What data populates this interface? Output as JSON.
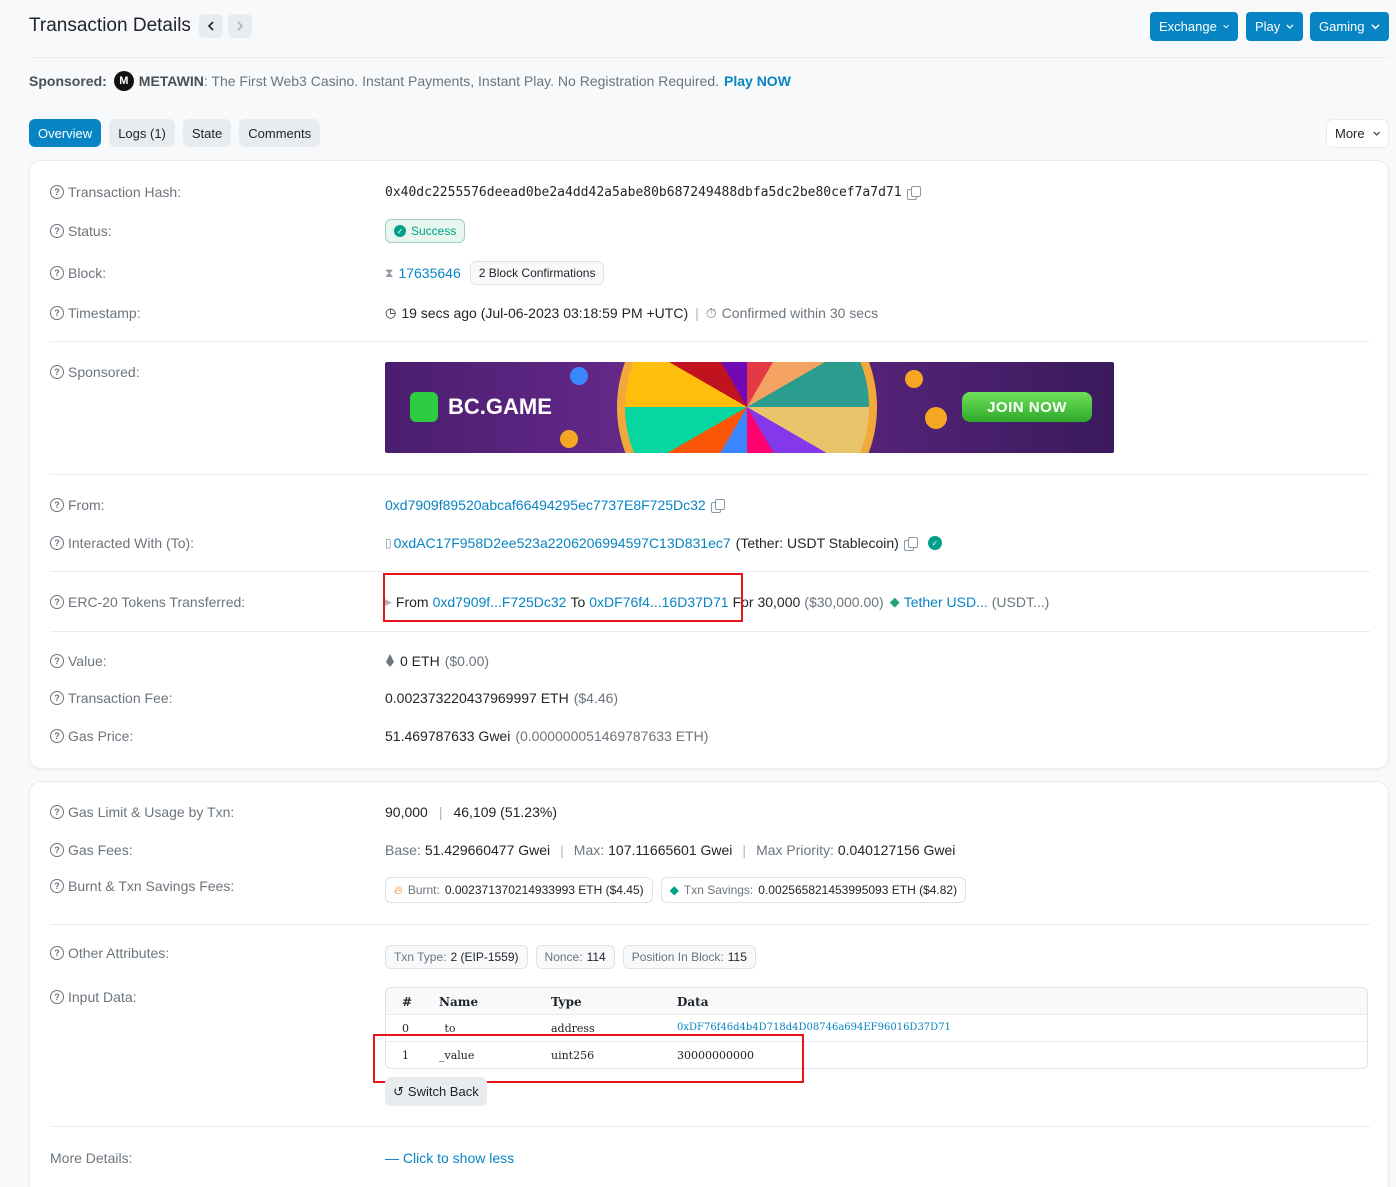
{
  "header": {
    "title": "Transaction Details",
    "buttons": [
      "Exchange",
      "Play",
      "Gaming"
    ]
  },
  "sponsored_line": {
    "label": "Sponsored:",
    "brand": "METAWIN",
    "text": ": The First Web3 Casino. Instant Payments, Instant Play. No Registration Required.",
    "cta": "Play NOW"
  },
  "tabs": [
    "Overview",
    "Logs (1)",
    "State",
    "Comments"
  ],
  "more_label": "More",
  "overview": {
    "tx_hash_label": "Transaction Hash:",
    "tx_hash": "0x40dc2255576deead0be2a4dd42a5abe80b687249488dbfa5dc2be80cef7a7d71",
    "status_label": "Status:",
    "status": "Success",
    "block_label": "Block:",
    "block": "17635646",
    "confirmations": "2 Block Confirmations",
    "timestamp_label": "Timestamp:",
    "timestamp": "19 secs ago (Jul-06-2023 03:18:59 PM +UTC)",
    "confirmed": "Confirmed within 30 secs",
    "sponsored_label": "Sponsored:",
    "banner_brand": "BC.GAME",
    "banner_cta": "JOIN NOW",
    "from_label": "From:",
    "from": "0xd7909f89520abcaf66494295ec7737E8F725Dc32",
    "to_label": "Interacted With (To):",
    "to": "0xdAC17F958D2ee523a2206206994597C13D831ec7",
    "to_name": "(Tether: USDT Stablecoin)",
    "erc20_label": "ERC-20 Tokens Transferred:",
    "erc20_from_word": "From",
    "erc20_from": "0xd7909f...F725Dc32",
    "erc20_to_word": "To",
    "erc20_to": "0xDF76f4...16D37D71",
    "erc20_for": "For 30,000",
    "erc20_usd": "($30,000.00)",
    "erc20_token": "Tether USD...",
    "erc20_symbol": "(USDT...)",
    "value_label": "Value:",
    "value": "0 ETH",
    "value_usd": "($0.00)",
    "fee_label": "Transaction Fee:",
    "fee": "0.002373220437969997 ETH",
    "fee_usd": "($4.46)",
    "gas_price_label": "Gas Price:",
    "gas_price": "51.469787633 Gwei",
    "gas_price_eth": "(0.000000051469787633 ETH)"
  },
  "details": {
    "gas_limit_label": "Gas Limit & Usage by Txn:",
    "gas_limit": "90,000",
    "gas_used": "46,109 (51.23%)",
    "gas_fees_label": "Gas Fees:",
    "base_k": "Base:",
    "base_v": "51.429660477 Gwei",
    "max_k": "Max:",
    "max_v": "107.11665601 Gwei",
    "prio_k": "Max Priority:",
    "prio_v": "0.040127156 Gwei",
    "burnt_label": "Burnt & Txn Savings Fees:",
    "burnt_k": "Burnt:",
    "burnt_v": "0.002371370214933993 ETH ($4.45)",
    "savings_k": "Txn Savings:",
    "savings_v": "0.002565821453995093 ETH ($4.82)",
    "other_label": "Other Attributes:",
    "txn_type_k": "Txn Type:",
    "txn_type_v": "2 (EIP-1559)",
    "nonce_k": "Nonce:",
    "nonce_v": "114",
    "pos_k": "Position In Block:",
    "pos_v": "115",
    "input_label": "Input Data:",
    "input_headers": [
      "#",
      "Name",
      "Type",
      "Data"
    ],
    "input_rows": [
      {
        "idx": "0",
        "name": "_to",
        "type": "address",
        "data": "0xDF76f46d4b4D718d4D08746a694EF96016D37D71"
      },
      {
        "idx": "1",
        "name": "_value",
        "type": "uint256",
        "data": "30000000000"
      }
    ],
    "switch_back": "Switch Back",
    "more_details_label": "More Details:",
    "show_less": "— Click to show less"
  }
}
